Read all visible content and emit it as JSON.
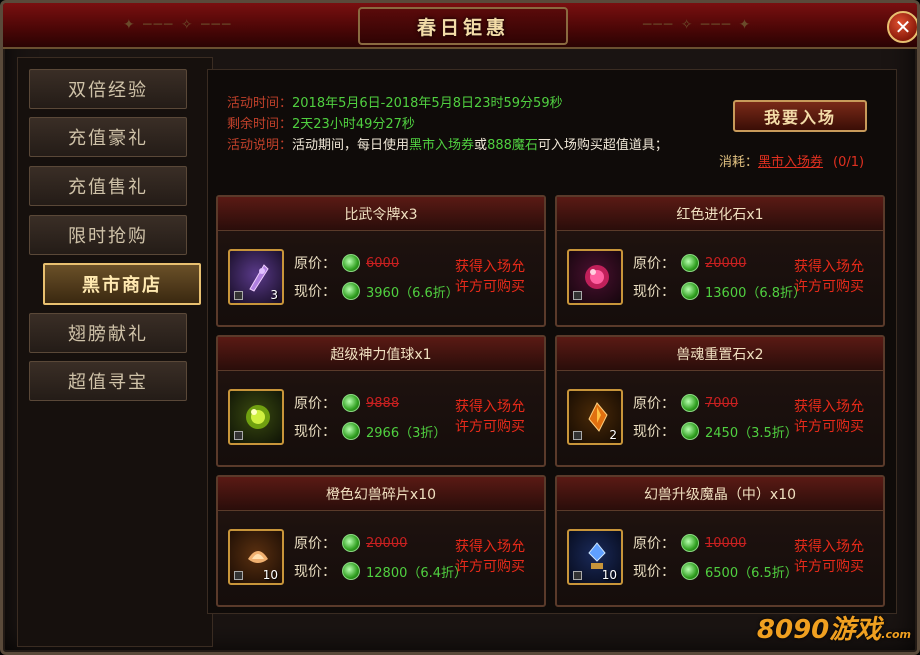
{
  "window": {
    "title": "春日钜惠",
    "close_icon": "close-icon"
  },
  "sidebar": {
    "items": [
      {
        "label": "双倍经验",
        "active": false
      },
      {
        "label": "充值豪礼",
        "active": false
      },
      {
        "label": "充值售礼",
        "active": false
      },
      {
        "label": "限时抢购",
        "active": false
      },
      {
        "label": "黑市商店",
        "active": true
      },
      {
        "label": "翅膀献礼",
        "active": false
      },
      {
        "label": "超值寻宝",
        "active": false
      }
    ]
  },
  "info": {
    "time_label": "活动时间：",
    "time_value": "2018年5月6日-2018年5月8日23时59分59秒",
    "remaining_label": "剩余时间：",
    "remaining_value": "2天23小时49分27秒",
    "desc_label": "活动说明：",
    "desc_part1": "活动期间，每日使用",
    "desc_ticket": "黑市入场券",
    "desc_or": "或",
    "desc_stone": "888魔石",
    "desc_part2": "可入场购买超值道具；"
  },
  "enter_button": "我要入场",
  "consume": {
    "label": "消耗：",
    "ticket": "黑市入场券",
    "count": "(0/1)"
  },
  "labels": {
    "original_price": "原价：",
    "current_price": "现价：",
    "requirement_line1": "获得入场允",
    "requirement_line2": "许方可购买"
  },
  "colors": {
    "accent_gold": "#e8c070",
    "price_green": "#50d040",
    "warning_red": "#e82a1a"
  },
  "items": [
    {
      "name": "比武令牌x3",
      "quantity": "3",
      "original": "6000",
      "current": "3960（6.6折）",
      "icon": "token-icon"
    },
    {
      "name": "红色进化石x1",
      "quantity": "",
      "original": "20000",
      "current": "13600（6.8折）",
      "icon": "red-orb-icon"
    },
    {
      "name": "超级神力值球x1",
      "quantity": "",
      "original": "9888",
      "current": "2966（3折）",
      "icon": "green-orb-icon"
    },
    {
      "name": "兽魂重置石x2",
      "quantity": "2",
      "original": "7000",
      "current": "2450（3.5折）",
      "icon": "amber-crystal-icon"
    },
    {
      "name": "橙色幻兽碎片x10",
      "quantity": "10",
      "original": "20000",
      "current": "12800（6.4折）",
      "icon": "orange-shard-icon"
    },
    {
      "name": "幻兽升级魔晶（中）x10",
      "quantity": "10",
      "original": "10000",
      "current": "6500（6.5折）",
      "icon": "blue-crystal-icon"
    }
  ],
  "watermark": {
    "text": "8090游戏",
    "sub": ".com"
  }
}
